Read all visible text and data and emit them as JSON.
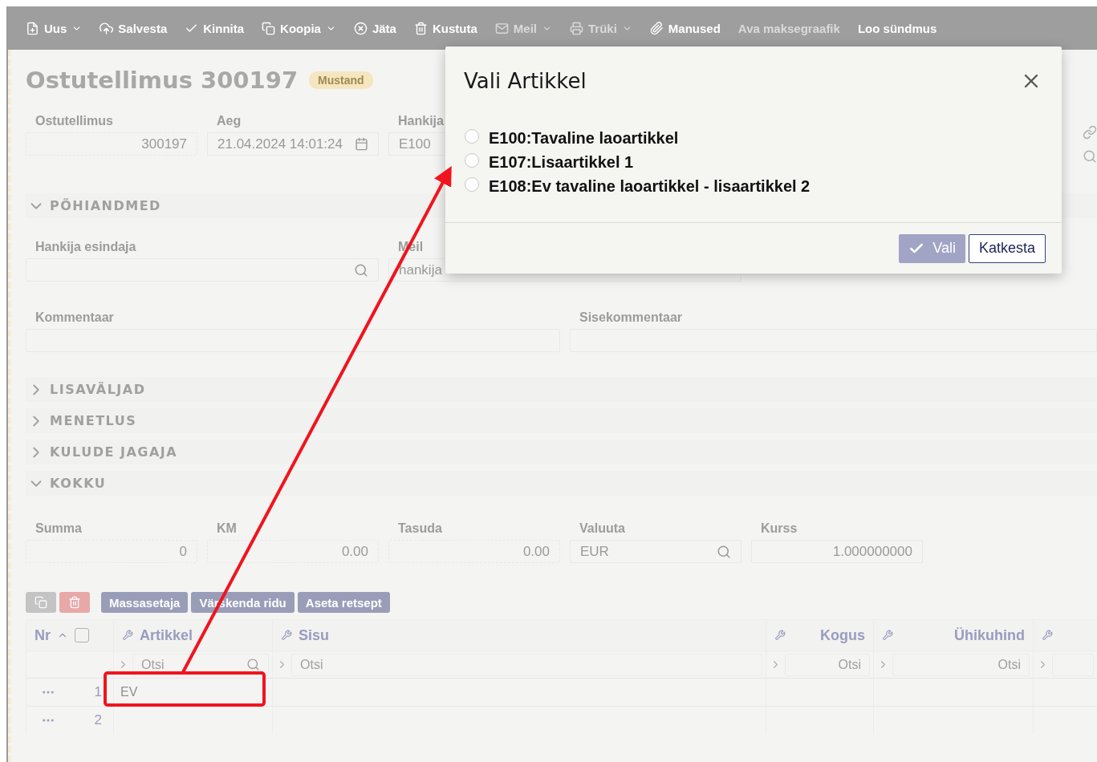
{
  "toolbar": [
    {
      "label": "Uus",
      "dropdown": true,
      "disabled": false
    },
    {
      "label": "Salvesta",
      "dropdown": false,
      "disabled": false
    },
    {
      "label": "Kinnita",
      "dropdown": false,
      "disabled": false
    },
    {
      "label": "Koopia",
      "dropdown": true,
      "disabled": false
    },
    {
      "label": "Jäta",
      "dropdown": false,
      "disabled": false
    },
    {
      "label": "Kustuta",
      "dropdown": false,
      "disabled": false
    },
    {
      "label": "Meil",
      "dropdown": true,
      "disabled": true
    },
    {
      "label": "Trüki",
      "dropdown": true,
      "disabled": true
    },
    {
      "label": "Manused",
      "dropdown": false,
      "disabled": false
    },
    {
      "label": "Ava maksegraafik",
      "dropdown": false,
      "disabled": true
    },
    {
      "label": "Loo sündmus",
      "dropdown": false,
      "disabled": false
    }
  ],
  "title": "Ostutellimus 300197",
  "status": "Mustand",
  "header_fields": [
    {
      "label": "Ostutellimus",
      "value": "300197",
      "kind": "number"
    },
    {
      "label": "Aeg",
      "value": "21.04.2024 14:01:24",
      "kind": "date"
    },
    {
      "label": "Hankija",
      "value": "E100",
      "kind": "text"
    }
  ],
  "sections_top": [
    {
      "label": "PÕHIANDMED",
      "expanded": true
    }
  ],
  "contact": {
    "representative_label": "Hankija esindaja",
    "email_label": "Meil",
    "email_placeholder": "hankija"
  },
  "comments": [
    {
      "label": "Kommentaar"
    },
    {
      "label": "Sisekommentaar"
    }
  ],
  "sections": [
    {
      "label": "LISAVÄLJAD",
      "expanded": false
    },
    {
      "label": "MENETLUS",
      "expanded": false
    },
    {
      "label": "KULUDE JAGAJA",
      "expanded": false
    },
    {
      "label": "KOKKU",
      "expanded": true
    }
  ],
  "totals": [
    {
      "label": "Summa",
      "value": "0",
      "kind": "number"
    },
    {
      "label": "KM",
      "value": "0.00",
      "kind": "number"
    },
    {
      "label": "Tasuda",
      "value": "0.00",
      "kind": "number"
    },
    {
      "label": "Valuuta",
      "value": "EUR",
      "kind": "lookup"
    },
    {
      "label": "Kurss",
      "value": "1.000000000",
      "kind": "plain"
    }
  ],
  "row_buttons": [
    "Massasetaja",
    "Värskenda ridu",
    "Aseta retsept"
  ],
  "table": {
    "columns": [
      {
        "label": "Nr",
        "kind": "index"
      },
      {
        "label": "Artikkel",
        "kind": "text",
        "filter": "Otsi"
      },
      {
        "label": "Sisu",
        "kind": "text",
        "filter": "Otsi"
      },
      {
        "label": "Kogus",
        "kind": "number",
        "filter": "Otsi"
      },
      {
        "label": "Ühikuhind",
        "kind": "number",
        "filter": "Otsi"
      },
      {
        "kind": "text"
      }
    ],
    "select_all": {
      "checked": false
    },
    "rows": [
      {
        "nr": "1",
        "article": "EV"
      },
      {
        "nr": "2"
      }
    ]
  },
  "dialog": {
    "title": "Vali Artikkel",
    "options": [
      {
        "label": "E100:Tavaline laoartikkel",
        "selected": false
      },
      {
        "label": "E107:Lisaartikkel 1",
        "selected": false
      },
      {
        "label": "E108:Ev tavaline laoartikkel - lisaartikkel 2",
        "selected": false
      }
    ],
    "ok": "Vali",
    "cancel": "Katkesta"
  }
}
